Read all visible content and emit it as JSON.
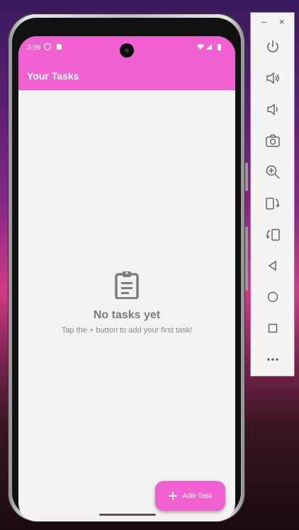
{
  "statusbar": {
    "time": "3:59"
  },
  "app": {
    "title": "Your Tasks"
  },
  "empty_state": {
    "icon": "clipboard-icon",
    "heading": "No tasks yet",
    "subtext": "Tap the + button to add your first task!"
  },
  "fab": {
    "icon": "plus-icon",
    "label": "Add-Task"
  },
  "emulator_toolbar": {
    "minimize_label": "–",
    "close_label": "×",
    "buttons": [
      "power-icon",
      "volume-up-icon",
      "volume-down-icon",
      "camera-icon",
      "zoom-in-icon",
      "rotate-left-icon",
      "rotate-right-icon",
      "back-icon",
      "home-icon",
      "overview-icon",
      "more-icon"
    ]
  },
  "colors": {
    "accent": "#f060d0",
    "background": "#f2f2f2",
    "muted_text": "#7d7d7d"
  }
}
